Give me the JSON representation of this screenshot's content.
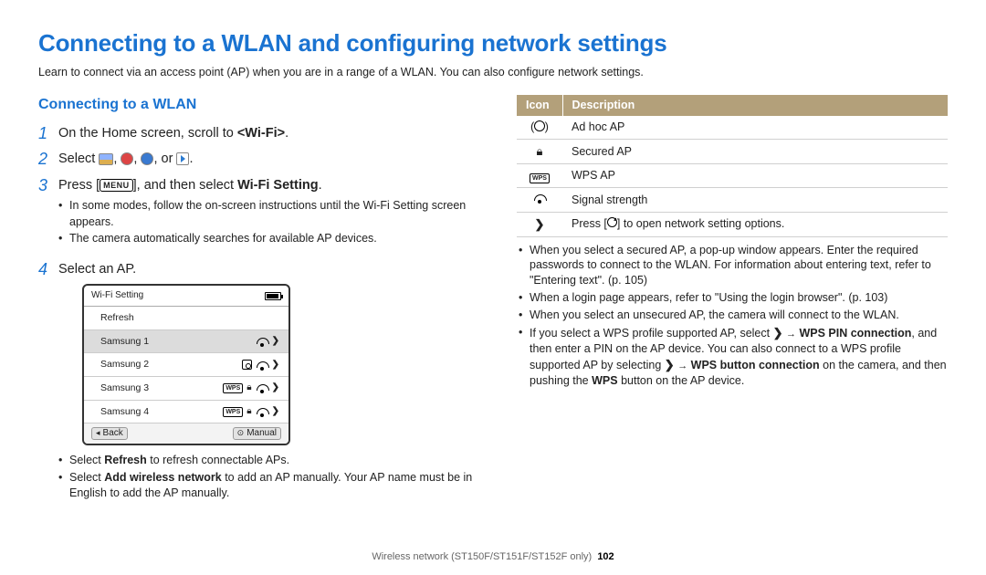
{
  "title": "Connecting to a WLAN and configuring network settings",
  "intro": "Learn to connect via an access point (AP) when you are in a range of a WLAN. You can also configure network settings.",
  "section_heading": "Connecting to a WLAN",
  "steps": {
    "s1": {
      "num": "1",
      "pre": "On the Home screen, scroll to ",
      "bold": "<Wi-Fi>",
      "post": "."
    },
    "s2": {
      "num": "2",
      "pre": "Select ",
      "post": "."
    },
    "s3": {
      "num": "3",
      "pre": "Press [",
      "menu": "MENU",
      "mid": "], and then select ",
      "bold": "Wi-Fi Setting",
      "post": "."
    },
    "s3_sub1": "In some modes, follow the on-screen instructions until the Wi-Fi Setting screen appears.",
    "s3_sub2": "The camera automatically searches for available AP devices.",
    "s4": {
      "num": "4",
      "text": "Select an AP."
    },
    "s4_sub1_pre": "Select ",
    "s4_sub1_bold": "Refresh",
    "s4_sub1_post": " to refresh connectable APs.",
    "s4_sub2_pre": "Select ",
    "s4_sub2_bold": "Add wireless network",
    "s4_sub2_post": " to add an AP manually. Your AP name must be in English to add the AP manually."
  },
  "mock": {
    "title": "Wi-Fi Setting",
    "rows": [
      "Refresh",
      "Samsung 1",
      "Samsung 2",
      "Samsung 3",
      "Samsung 4"
    ],
    "back": "Back",
    "manual": "Manual"
  },
  "table": {
    "h1": "Icon",
    "h2": "Description",
    "r1": "Ad hoc AP",
    "r2": "Secured AP",
    "r3": "WPS AP",
    "r4": "Signal strength",
    "r5_pre": "Press [",
    "r5_post": "] to open network setting options."
  },
  "right": {
    "b1": "When you select a secured AP, a pop-up window appears. Enter the required passwords to connect to the WLAN. For information about entering text, refer to \"Entering text\". (p. 105)",
    "b2": "When a login page appears, refer to \"Using the login browser\". (p. 103)",
    "b3": "When you select an unsecured AP, the camera will connect to the WLAN.",
    "b4_pre": "If you select a WPS profile supported AP, select ",
    "b4_b1": "WPS PIN connection",
    "b4_mid1": ", and then enter a PIN on the AP device. You can also connect to a WPS profile supported AP by selecting ",
    "b4_b2": "WPS button connection",
    "b4_mid2": " on the camera, and then pushing the ",
    "b4_b3": "WPS",
    "b4_post": " button on the AP device."
  },
  "footer": {
    "text": "Wireless network  (ST150F/ST151F/ST152F only)",
    "page": "102"
  }
}
